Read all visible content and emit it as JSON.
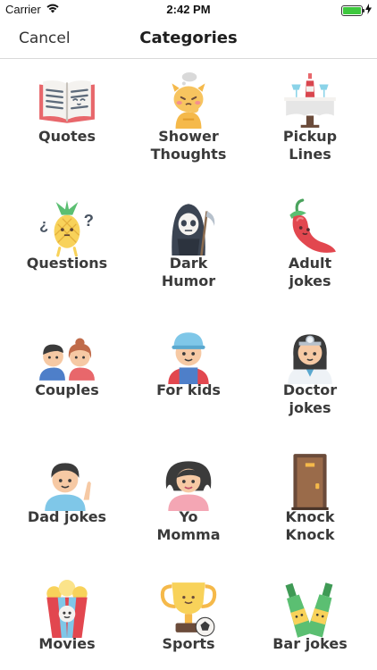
{
  "status": {
    "carrier": "Carrier",
    "time": "2:42 PM",
    "battery_level": 1.0
  },
  "nav": {
    "cancel_label": "Cancel",
    "title": "Categories"
  },
  "categories": [
    {
      "label": "Quotes",
      "icon": "open-book-icon"
    },
    {
      "label": "Shower\nThoughts",
      "icon": "thinking-cat-icon"
    },
    {
      "label": "Pickup\nLines",
      "icon": "dinner-table-icon"
    },
    {
      "label": "Questions",
      "icon": "pineapple-question-icon"
    },
    {
      "label": "Dark\nHumor",
      "icon": "grim-reaper-icon"
    },
    {
      "label": "Adult\njokes",
      "icon": "chili-pepper-icon"
    },
    {
      "label": "Couples",
      "icon": "couple-icon"
    },
    {
      "label": "For kids",
      "icon": "kid-icon"
    },
    {
      "label": "Doctor\njokes",
      "icon": "doctor-icon"
    },
    {
      "label": "Dad jokes",
      "icon": "dad-icon"
    },
    {
      "label": "Yo\nMomma",
      "icon": "mom-icon"
    },
    {
      "label": "Knock\nKnock",
      "icon": "door-icon"
    },
    {
      "label": "Movies",
      "icon": "popcorn-icon"
    },
    {
      "label": "Sports",
      "icon": "trophy-icon"
    },
    {
      "label": "Bar jokes",
      "icon": "beer-bottles-icon"
    }
  ]
}
